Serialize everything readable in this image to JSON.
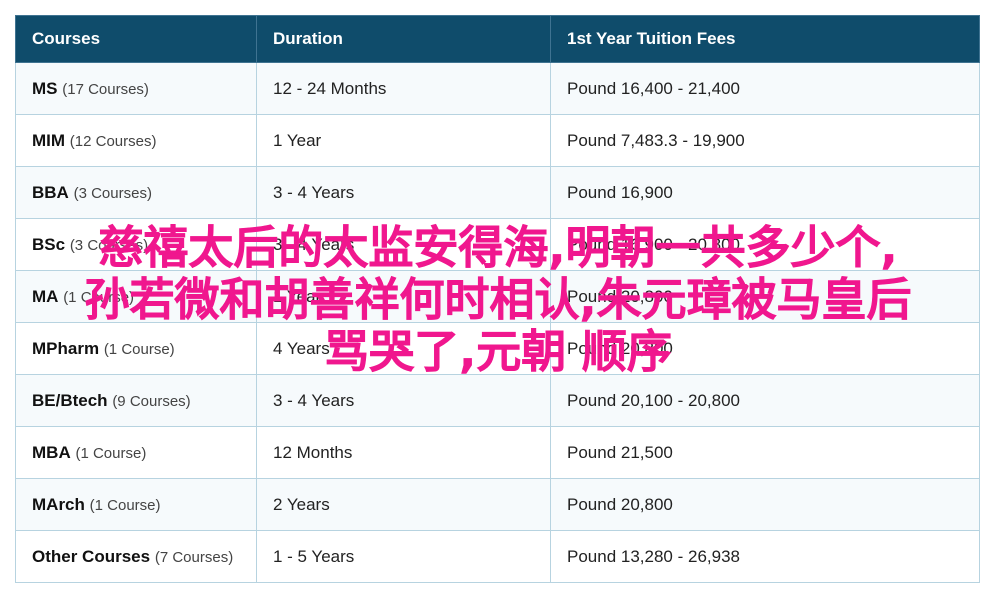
{
  "table": {
    "headers": {
      "courses": "Courses",
      "duration": "Duration",
      "fees": "1st Year Tuition Fees"
    },
    "rows": [
      {
        "name": "MS",
        "count": "(17 Courses)",
        "duration": "12 - 24 Months",
        "fees": "Pound 16,400 - 21,400"
      },
      {
        "name": "MIM",
        "count": "(12 Courses)",
        "duration": "1 Year",
        "fees": "Pound 7,483.3 - 19,900"
      },
      {
        "name": "BBA",
        "count": "(3 Courses)",
        "duration": "3 - 4 Years",
        "fees": "Pound 16,900"
      },
      {
        "name": "BSc",
        "count": "(3 Courses)",
        "duration": "3 - 4 Years",
        "fees": "Pound 16,900 - 20,800"
      },
      {
        "name": "MA",
        "count": "(1 Course)",
        "duration": "1 Year",
        "fees": "Pound 20,800"
      },
      {
        "name": "MPharm",
        "count": "(1 Course)",
        "duration": "4 Years",
        "fees": "Pound 20,800"
      },
      {
        "name": "BE/Btech",
        "count": "(9 Courses)",
        "duration": "3 - 4 Years",
        "fees": "Pound 20,100 - 20,800"
      },
      {
        "name": "MBA",
        "count": "(1 Course)",
        "duration": "12 Months",
        "fees": "Pound 21,500"
      },
      {
        "name": "MArch",
        "count": "(1 Course)",
        "duration": "2 Years",
        "fees": "Pound 20,800"
      },
      {
        "name": "Other Courses",
        "count": "(7 Courses)",
        "duration": "1 - 5 Years",
        "fees": "Pound 13,280 - 26,938"
      }
    ]
  },
  "overlay": {
    "line1": "慈禧太后的太监安得海,明朝一共多少个,",
    "line2": "孙若微和胡善祥何时相认,朱元璋被马皇后",
    "line3": "骂哭了,元朝 顺序",
    "color": "#f0178e"
  },
  "colors": {
    "header_bg": "#0f4c6b",
    "border": "#b7d3e0"
  }
}
